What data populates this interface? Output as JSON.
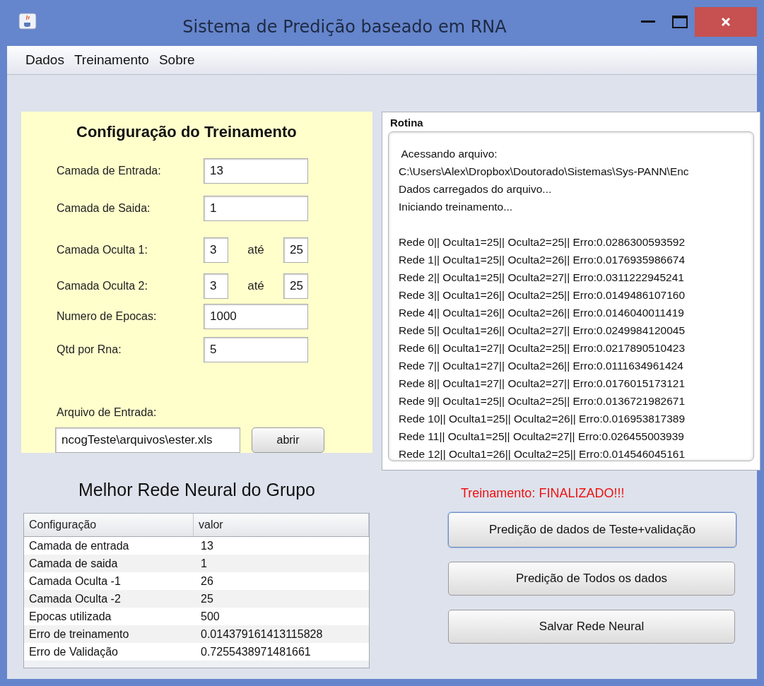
{
  "window": {
    "title": "Sistema de Predição baseado em RNA"
  },
  "menu": [
    "Dados",
    "Treinamento",
    "Sobre"
  ],
  "config": {
    "title": "Configuração do Treinamento",
    "fields": [
      {
        "kind": "single",
        "label": "Camada de Entrada:",
        "value": "13"
      },
      {
        "kind": "single",
        "label": "Camada de Saida:",
        "value": "1"
      },
      {
        "kind": "range",
        "label": "Camada Oculta 1:",
        "from": "3",
        "separator": "até",
        "to": "25"
      },
      {
        "kind": "range",
        "label": "Camada Oculta 2:",
        "from": "3",
        "separator": "até",
        "to": "25"
      },
      {
        "kind": "single",
        "label": "Numero de Epocas:",
        "value": "1000"
      },
      {
        "kind": "single",
        "label": "Qtd por Rna:",
        "value": "5"
      }
    ],
    "file": {
      "label": "Arquivo de Entrada:",
      "value": "ncogTeste\\arquivos\\ester.xls",
      "button": "abrir"
    }
  },
  "log": {
    "title": "Rotina",
    "header_lines": [
      " Acessando arquivo:",
      "C:\\Users\\Alex\\Dropbox\\Doutorado\\Sistemas\\Sys-PANN\\Enc",
      "Dados carregados do arquivo...",
      "Iniciando treinamento..."
    ],
    "result_lines": [
      "Rede 0|| Oculta1=25|| Oculta2=25|| Erro:0.0286300593592",
      "Rede 1|| Oculta1=25|| Oculta2=26|| Erro:0.0176935986674",
      "Rede 2|| Oculta1=25|| Oculta2=27|| Erro:0.0311222945241",
      "Rede 3|| Oculta1=26|| Oculta2=25|| Erro:0.0149486107160",
      "Rede 4|| Oculta1=26|| Oculta2=26|| Erro:0.0146040011419",
      "Rede 5|| Oculta1=26|| Oculta2=27|| Erro:0.0249984120045",
      "Rede 6|| Oculta1=27|| Oculta2=25|| Erro:0.0217890510423",
      "Rede 7|| Oculta1=27|| Oculta2=26|| Erro:0.0111634961424",
      "Rede 8|| Oculta1=27|| Oculta2=27|| Erro:0.0176015173121",
      "Rede 9|| Oculta1=25|| Oculta2=25|| Erro:0.0136721982671",
      "Rede 10|| Oculta1=25|| Oculta2=26|| Erro:0.016953817389",
      "Rede 11|| Oculta1=25|| Oculta2=27|| Erro:0.026455003939",
      "Rede 12|| Oculta1=26|| Oculta2=25|| Erro:0.014546045161"
    ]
  },
  "best_network": {
    "title": "Melhor Rede Neural do Grupo",
    "columns": [
      "Configuração",
      "valor"
    ],
    "rows": [
      [
        "Camada de entrada",
        "13"
      ],
      [
        "Camada de saida",
        "1"
      ],
      [
        "Camada Oculta -1",
        "26"
      ],
      [
        "Camada Oculta -2",
        "25"
      ],
      [
        "Epocas utilizada",
        "500"
      ],
      [
        "Erro de treinamento",
        "0.014379161413115828"
      ],
      [
        "Erro de Validação",
        "0.7255438971481661"
      ]
    ]
  },
  "status": "Treinamento: FINALIZADO!!!",
  "buttons": [
    {
      "label": "Predição de dados de Teste+validação",
      "focused": true
    },
    {
      "label": "Predição de Todos os dados",
      "focused": false
    },
    {
      "label": "Salvar Rede Neural",
      "focused": false
    }
  ]
}
